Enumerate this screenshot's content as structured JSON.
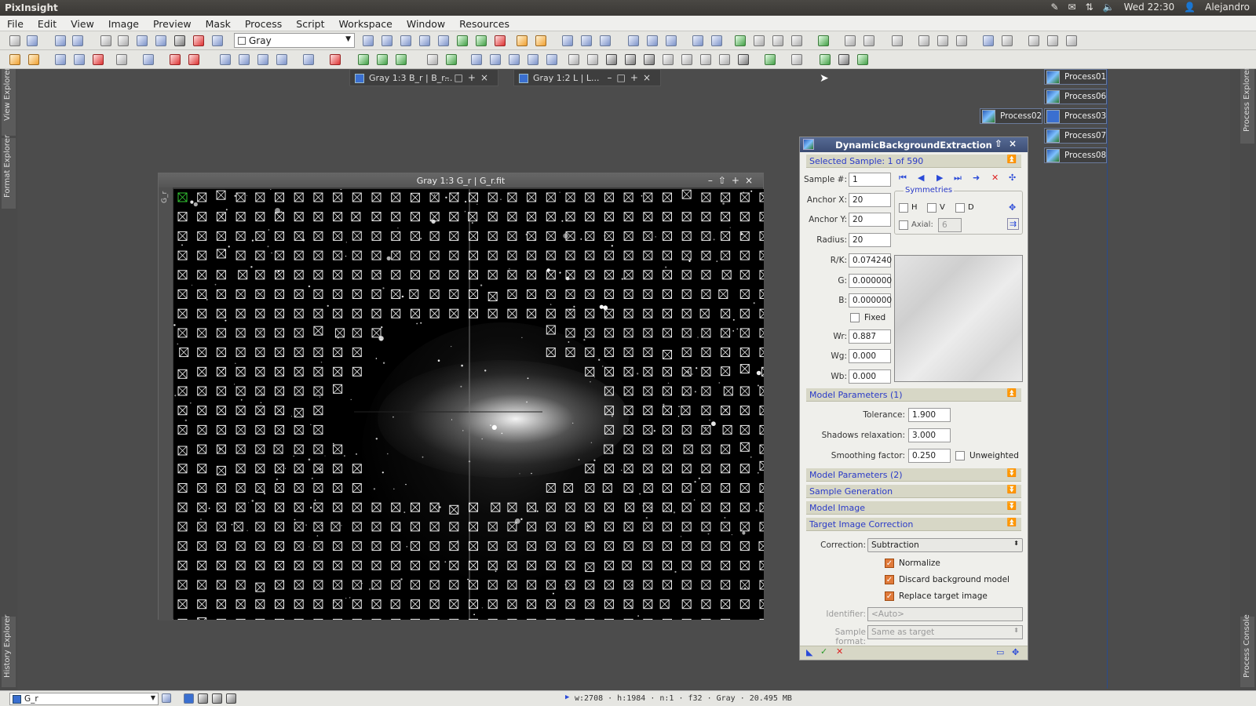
{
  "system": {
    "app_title": "PixInsight",
    "clock": "Wed 22:30",
    "user": "Alejandro"
  },
  "menu": [
    "File",
    "Edit",
    "View",
    "Image",
    "Preview",
    "Mask",
    "Process",
    "Script",
    "Workspace",
    "Window",
    "Resources"
  ],
  "toolbar": {
    "colorspace_select": "Gray"
  },
  "side_tabs": {
    "left_top": "View Explorer",
    "left_mid": "Format Explorer",
    "left_bottom": "History Explorer",
    "right_top": "Process Explorer",
    "right_bottom": "Process Console"
  },
  "view_tabs": [
    {
      "label": "Gray 1:3 B_r | B_r..."
    },
    {
      "label": "Gray 1:2 L | L..."
    }
  ],
  "process_icons": [
    "Process01",
    "Process06",
    "Process02",
    "Process03",
    "Process07",
    "Process08"
  ],
  "image_window": {
    "title": "Gray 1:3 G_r | G_r.fit",
    "side_label": "G_r"
  },
  "dbe": {
    "title": "DynamicBackgroundExtraction",
    "selected_sample": "Selected Sample: 1 of 590",
    "sample_label": "Sample #:",
    "sample_value": "1",
    "anchor_x_label": "Anchor X:",
    "anchor_x": "20",
    "anchor_y_label": "Anchor Y:",
    "anchor_y": "20",
    "radius_label": "Radius:",
    "radius": "20",
    "rk_label": "R/K:",
    "rk": "0.074240",
    "g_label": "G:",
    "g": "0.000000",
    "b_label": "B:",
    "b": "0.000000",
    "fixed_label": "Fixed",
    "wr_label": "Wr:",
    "wr": "0.887",
    "wg_label": "Wg:",
    "wg": "0.000",
    "wb_label": "Wb:",
    "wb": "0.000",
    "symmetries": "Symmetries",
    "sym_h": "H",
    "sym_v": "V",
    "sym_d": "D",
    "axial_label": "Axial:",
    "axial_value": "6",
    "model_params_1": "Model Parameters (1)",
    "tolerance_label": "Tolerance:",
    "tolerance": "1.900",
    "shadows_label": "Shadows relaxation:",
    "shadows": "3.000",
    "smoothing_label": "Smoothing factor:",
    "smoothing": "0.250",
    "unweighted_label": "Unweighted",
    "model_params_2": "Model Parameters (2)",
    "sample_generation": "Sample Generation",
    "model_image": "Model Image",
    "target_correction": "Target Image Correction",
    "correction_label": "Correction:",
    "correction_value": "Subtraction",
    "normalize_label": "Normalize",
    "discard_label": "Discard background model",
    "replace_label": "Replace target image",
    "identifier_label": "Identifier:",
    "identifier_placeholder": "<Auto>",
    "sample_format_label": "Sample format:",
    "sample_format_value": "Same as target"
  },
  "status": {
    "view": "G_r",
    "info": "w:2708 · h:1984 · n:1 · f32 · Gray · 20.495 MB"
  }
}
